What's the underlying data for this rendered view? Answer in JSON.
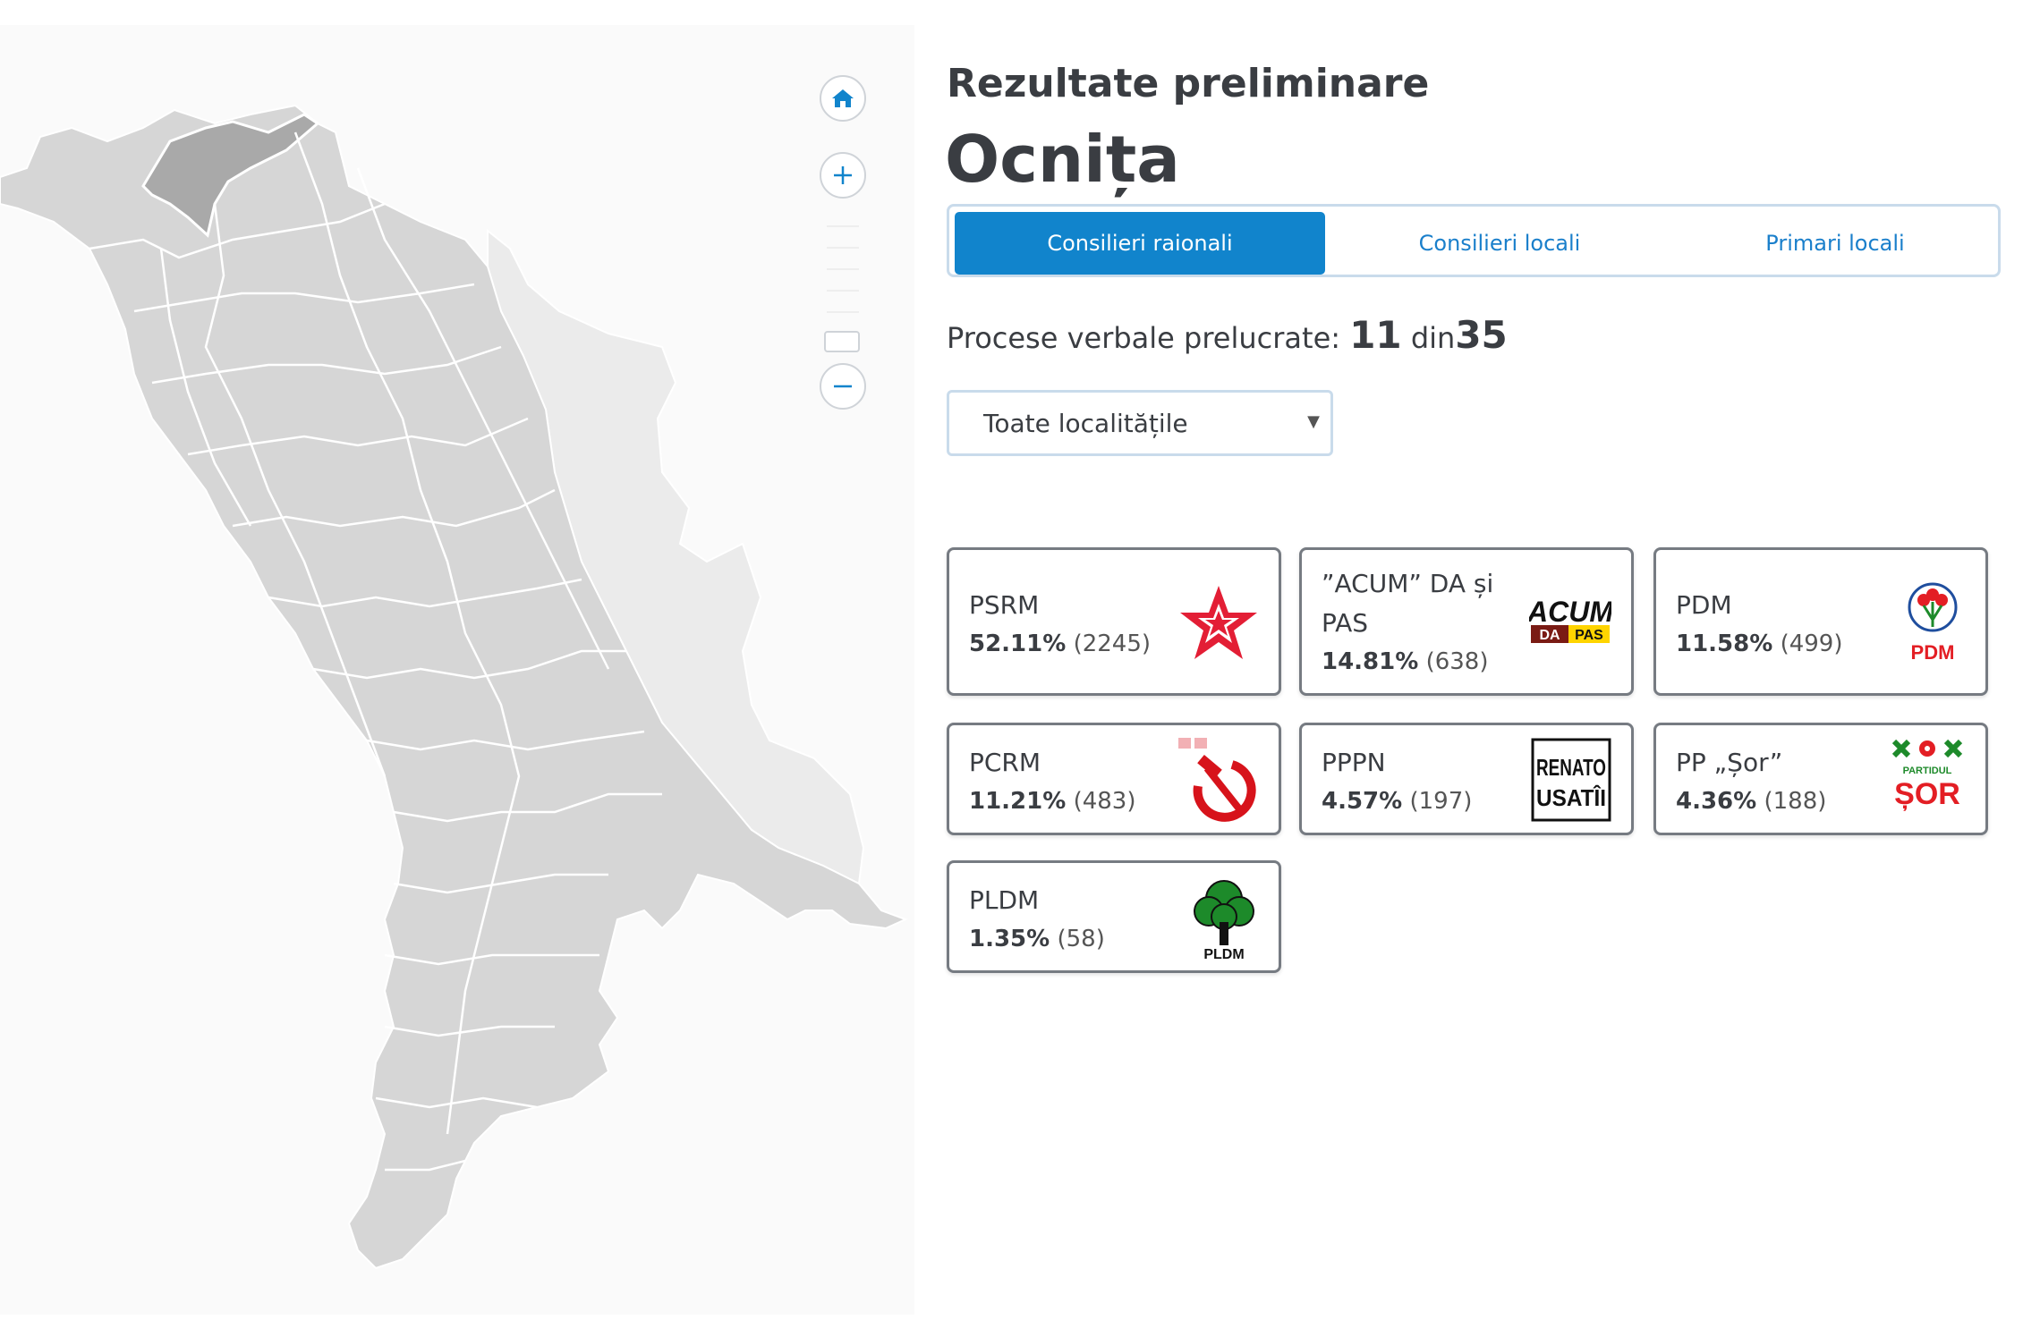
{
  "header": {
    "title": "Rezultate preliminare",
    "district": "Ocnița"
  },
  "tabs": [
    {
      "label": "Consilieri raionali",
      "active": true
    },
    {
      "label": "Consilieri locali",
      "active": false
    },
    {
      "label": "Primari locali",
      "active": false
    }
  ],
  "processed": {
    "label": "Procese verbale prelucrate:",
    "done": "11",
    "sep": "din",
    "total": "35"
  },
  "locality_select": {
    "value": "Toate localitățile"
  },
  "map_controls": {
    "home_icon": "home-icon",
    "zoom_in_icon": "plus-icon",
    "zoom_out_icon": "minus-icon"
  },
  "map": {
    "selected_district": "Ocnița",
    "colors": {
      "district_fill": "#d6d6d6",
      "selected_fill": "#a9a9a9",
      "transnistria_fill": "#ebebeb",
      "border": "#ffffff"
    }
  },
  "parties": [
    {
      "name": "PSRM",
      "percent": "52.11%",
      "count": "(2245)",
      "logo_icon": "psrm-star-logo",
      "color": "#e31e35"
    },
    {
      "name": "”ACUM” DA și PAS",
      "percent": "14.81%",
      "count": "(638)",
      "logo_icon": "acum-logo",
      "logo_text": "ACUM",
      "logo_sub1": "DA",
      "logo_sub2": "PAS",
      "color": "#ffd400"
    },
    {
      "name": "PDM",
      "percent": "11.58%",
      "count": "(499)",
      "logo_icon": "pdm-rose-logo",
      "logo_text": "PDM",
      "color": "#e31e24"
    },
    {
      "name": "PCRM",
      "percent": "11.21%",
      "count": "(483)",
      "logo_icon": "hammer-sickle-logo",
      "color": "#d7131b"
    },
    {
      "name": "PPPN",
      "percent": "4.57%",
      "count": "(197)",
      "logo_icon": "renato-usatii-logo",
      "logo_text1": "RENATO",
      "logo_text2": "USATÎI",
      "color": "#111111"
    },
    {
      "name": "PP „Șor”",
      "percent": "4.36%",
      "count": "(188)",
      "logo_icon": "sor-logo",
      "logo_text1": "PARTIDUL",
      "logo_text2": "ȘOR",
      "color": "#e31e24"
    },
    {
      "name": "PLDM",
      "percent": "1.35%",
      "count": "(58)",
      "logo_icon": "pldm-tree-logo",
      "logo_text": "PLDM",
      "color": "#1d8a2a"
    }
  ]
}
